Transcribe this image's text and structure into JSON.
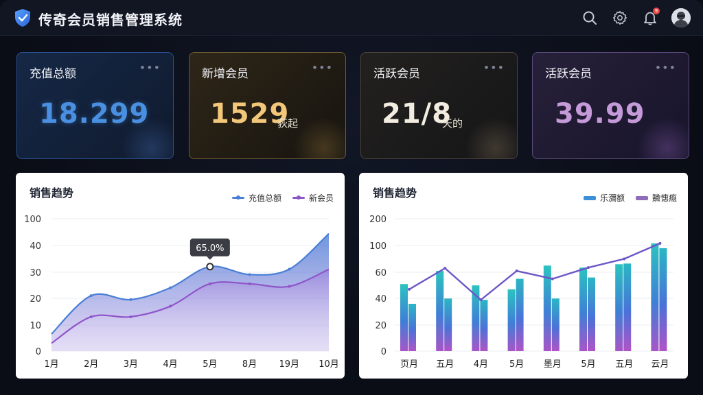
{
  "app": {
    "title": "传奇会员销售管理系统",
    "logo_icon": "shield-icon"
  },
  "topbar": {
    "icons": [
      "search-icon",
      "gear-icon",
      "bell-icon",
      "avatar"
    ],
    "notification_count": "9"
  },
  "cards": [
    {
      "title": "充值总额",
      "value": "18.299",
      "unit": "",
      "accent": "#4a90e2",
      "more": "•••"
    },
    {
      "title": "新增会员",
      "value": "1529",
      "unit": "荻起",
      "accent": "#f2c77a",
      "more": "•••"
    },
    {
      "title": "活跃会员",
      "value": "21/8",
      "unit": "天的",
      "accent": "#f3ece0",
      "more": "•••"
    },
    {
      "title": "活跃会员",
      "value": "39.99",
      "unit": "",
      "accent": "#c49ad8",
      "more": "•••"
    }
  ],
  "chart_left": {
    "title": "销售趋势",
    "legend": [
      "充值总额",
      "新会员"
    ],
    "tooltip": "65.0%"
  },
  "chart_right": {
    "title": "销售趋势",
    "legend": [
      "乐瀰额",
      "覹憓瘾"
    ]
  },
  "chart_data": [
    {
      "type": "area",
      "title": "销售趋势",
      "x": [
        "1月",
        "2月",
        "3月",
        "4月",
        "5月",
        "8月",
        "19月",
        "10月"
      ],
      "y_ticks": [
        "0",
        "10",
        "20",
        "30",
        "40",
        "100"
      ],
      "series": [
        {
          "name": "充值总额",
          "color": "#4a7fd6",
          "values": [
            6.5,
            21,
            19.5,
            24,
            32,
            29,
            31,
            44.5
          ]
        },
        {
          "name": "新会员",
          "color": "#8e55c9",
          "values": [
            3,
            13,
            13,
            17,
            25.5,
            25.5,
            24.5,
            31
          ]
        }
      ],
      "tooltip": {
        "label": "65.0%",
        "at_index": 4
      },
      "grid": true,
      "legend_position": "top-right"
    },
    {
      "type": "bar",
      "title": "销售趋势",
      "categories": [
        "页月",
        "五月",
        "4月",
        "5月",
        "墨月",
        "5月",
        "五月",
        "云月"
      ],
      "y_ticks": [
        "0",
        "20",
        "40",
        "60",
        "100",
        "200"
      ],
      "series": [
        {
          "name": "乐瀰额",
          "color": "#2bc3c0",
          "values": [
            51,
            62,
            50,
            47,
            70,
            67,
            72,
            108
          ]
        },
        {
          "name": "覹憓瘾",
          "color": "#3a8fd8",
          "values": [
            36,
            40,
            39,
            55,
            40,
            56,
            73,
            96
          ]
        }
      ],
      "line": {
        "name": "trend",
        "color": "#6d55c8",
        "values": [
          47,
          66,
          39,
          62,
          55,
          67,
          80,
          108
        ]
      },
      "grid": true,
      "legend_position": "top-right"
    }
  ]
}
